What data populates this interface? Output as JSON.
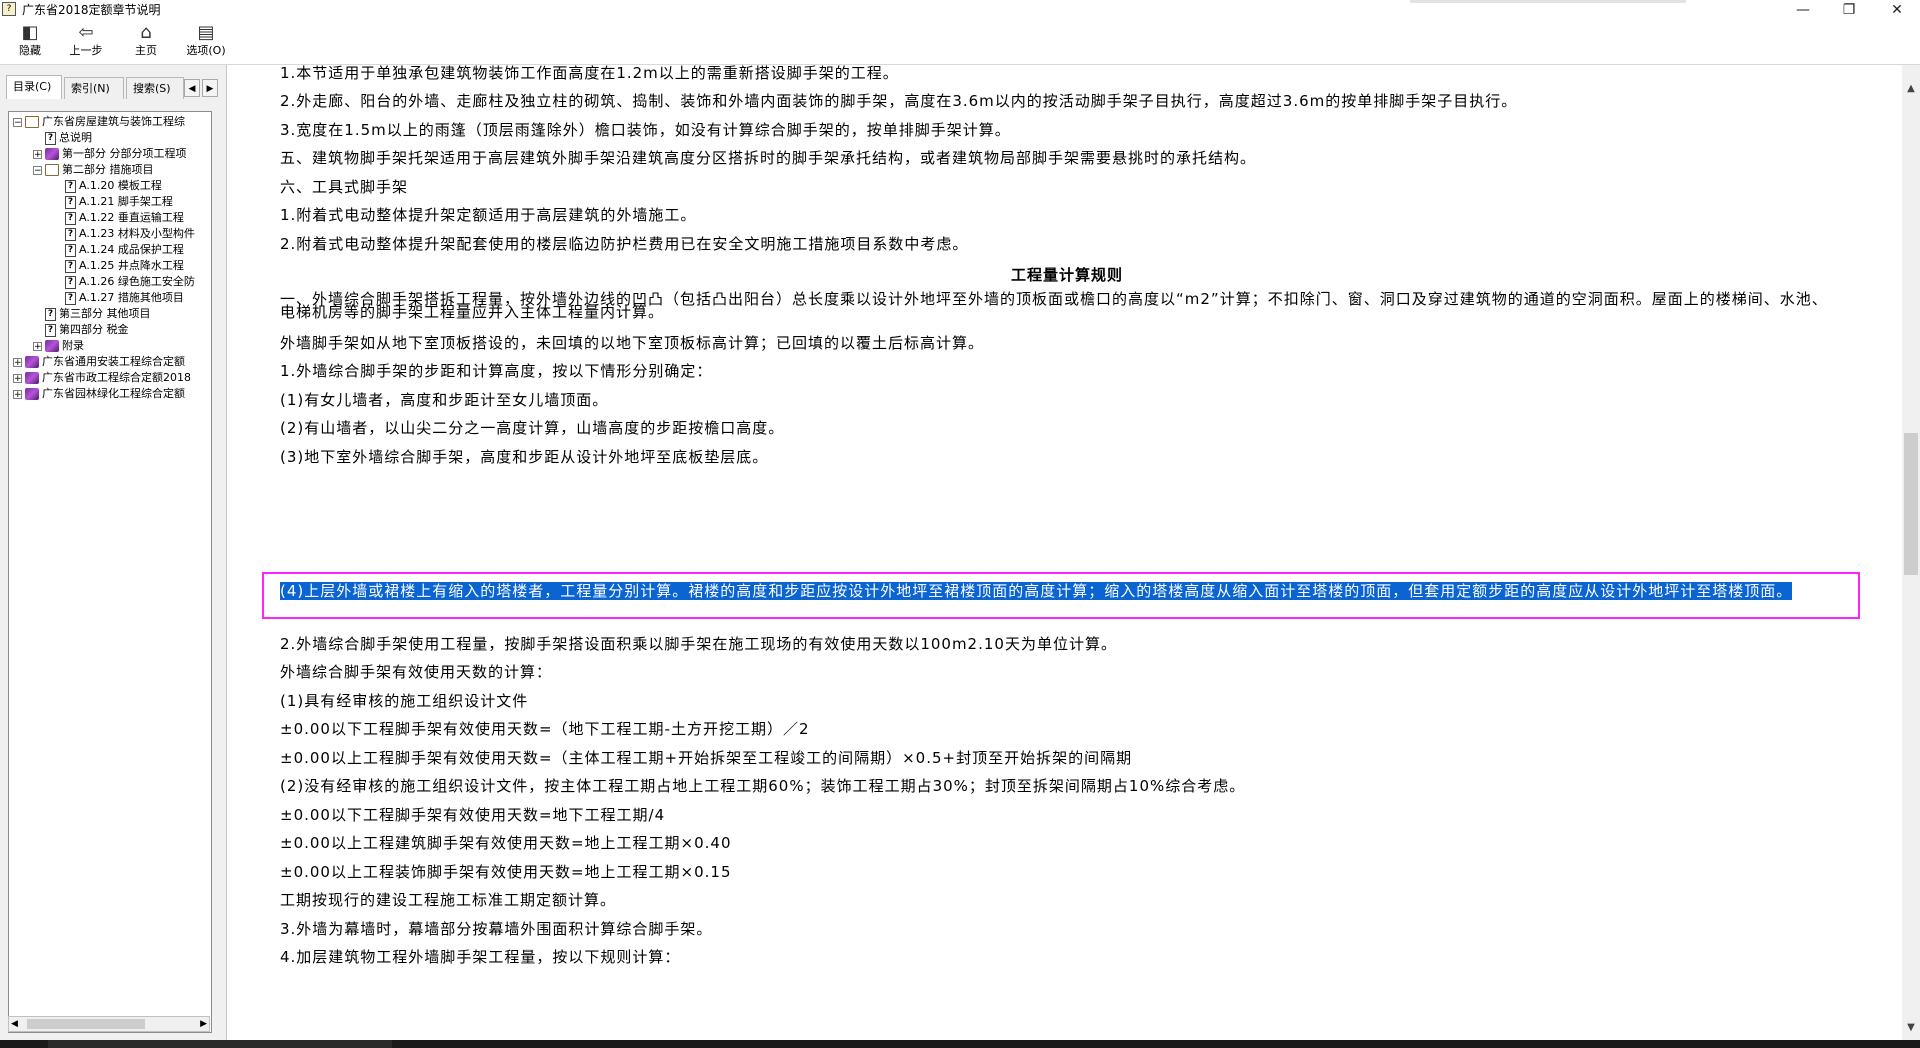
{
  "window": {
    "title": "广东省2018定额章节说明",
    "minimize": "—",
    "maximize": "❐",
    "close": "✕"
  },
  "toolbar": {
    "hide_label": "隐藏",
    "back_label": "上一步",
    "home_label": "主页",
    "options_label": "选项(O)"
  },
  "tabs": {
    "contents": "目录(C)",
    "index": "索引(N)",
    "search": "搜索(S)"
  },
  "tree": [
    {
      "label": "广东省房屋建筑与装饰工程综",
      "icon": "book-open",
      "expander": "⊟",
      "level": 0
    },
    {
      "label": "总说明",
      "icon": "help-page",
      "level": 1
    },
    {
      "label": "第一部分 分部分项工程项",
      "icon": "book",
      "expander": "⊞",
      "level": 1
    },
    {
      "label": "第二部分 措施项目",
      "icon": "book-open",
      "expander": "⊟",
      "level": 1
    },
    {
      "label": "A.1.20 模板工程",
      "icon": "help-page",
      "level": 2
    },
    {
      "label": "A.1.21 脚手架工程",
      "icon": "help-page",
      "level": 2
    },
    {
      "label": "A.1.22 垂直运输工程",
      "icon": "help-page",
      "level": 2
    },
    {
      "label": "A.1.23 材料及小型构件",
      "icon": "help-page",
      "level": 2
    },
    {
      "label": "A.1.24 成品保护工程",
      "icon": "help-page",
      "level": 2
    },
    {
      "label": "A.1.25 井点降水工程",
      "icon": "help-page",
      "level": 2
    },
    {
      "label": "A.1.26 绿色施工安全防",
      "icon": "help-page",
      "level": 2
    },
    {
      "label": "A.1.27 措施其他项目",
      "icon": "help-page",
      "level": 2
    },
    {
      "label": "第三部分 其他项目",
      "icon": "help-page",
      "level": 1
    },
    {
      "label": "第四部分 税金",
      "icon": "help-page",
      "level": 1
    },
    {
      "label": "附录",
      "icon": "book",
      "expander": "⊞",
      "level": 1
    },
    {
      "label": "广东省通用安装工程综合定额",
      "icon": "book",
      "expander": "⊞",
      "level": 0
    },
    {
      "label": "广东省市政工程综合定额2018",
      "icon": "book",
      "expander": "⊞",
      "level": 0
    },
    {
      "label": "广东省园林绿化工程综合定额",
      "icon": "book",
      "expander": "⊞",
      "level": 0
    }
  ],
  "content": {
    "p1": "1.本节适用于单独承包建筑物装饰工作面高度在1.2m以上的需重新搭设脚手架的工程。",
    "p2": "2.外走廊、阳台的外墙、走廊柱及独立柱的砌筑、捣制、装饰和外墙内面装饰的脚手架，高度在3.6m以内的按活动脚手架子目执行，高度超过3.6m的按单排脚手架子目执行。",
    "p3": "3.宽度在1.5m以上的雨篷（顶层雨篷除外）檐口装饰，如没有计算综合脚手架的，按单排脚手架计算。",
    "p4": "五、建筑物脚手架托架适用于高层建筑外脚手架沿建筑高度分区搭拆时的脚手架承托结构，或者建筑物局部脚手架需要悬挑时的承托结构。",
    "p5": "六、工具式脚手架",
    "p6": "1.附着式电动整体提升架定额适用于高层建筑的外墙施工。",
    "p7": "2.附着式电动整体提升架配套使用的楼层临边防护栏费用已在安全文明施工措施项目系数中考虑。",
    "heading": "工程量计算规则",
    "p8": "一、外墙综合脚手架搭拆工程量，按外墙外边线的凹凸（包括凸出阳台）总长度乘以设计外地坪至外墙的顶板面或檐口的高度以“m2”计算；不扣除门、窗、洞口及穿过建筑物的通道的空洞面积。屋面上的楼梯间、水池、电梯机房等的脚手架工程量应并入主体工程量内计算。",
    "p9": "外墙脚手架如从地下室顶板搭设的，未回填的以地下室顶板标高计算；已回填的以覆土后标高计算。",
    "p10": "1.外墙综合脚手架的步距和计算高度，按以下情形分别确定：",
    "p11": "(1)有女儿墙者，高度和步距计至女儿墙顶面。",
    "p12": "(2)有山墙者，以山尖二分之一高度计算，山墙高度的步距按檐口高度。",
    "p13": "(3)地下室外墙综合脚手架，高度和步距从设计外地坪至底板垫层底。",
    "p14": "(4)上层外墙或裙楼上有缩入的塔楼者，工程量分别计算。裙楼的高度和步距应按设计外地坪至裙楼顶面的高度计算；缩入的塔楼高度从缩入面计至塔楼的顶面，但套用定额步距的高度应从设计外地坪计至塔楼顶面。",
    "p15": "2.外墙综合脚手架使用工程量，按脚手架搭设面积乘以脚手架在施工现场的有效使用天数以100m2.10天为单位计算。",
    "p16": "外墙综合脚手架有效使用天数的计算：",
    "p17": "(1)具有经审核的施工组织设计文件",
    "p18": "±0.00以下工程脚手架有效使用天数=（地下工程工期-土方开挖工期）／2",
    "p19": "±0.00以上工程脚手架有效使用天数=（主体工程工期+开始拆架至工程竣工的间隔期）×0.5+封顶至开始拆架的间隔期",
    "p20": "(2)没有经审核的施工组织设计文件，按主体工程工期占地上工程工期60%；装饰工程工期占30%；封顶至拆架间隔期占10%综合考虑。",
    "p21": "±0.00以下工程脚手架有效使用天数=地下工程工期/4",
    "p22": "±0.00以上工程建筑脚手架有效使用天数=地上工程工期×0.40",
    "p23": "±0.00以上工程装饰脚手架有效使用天数=地上工程工期×0.15",
    "p24": "工期按现行的建设工程施工标准工期定额计算。",
    "p25": "3.外墙为幕墙时，幕墙部分按幕墙外围面积计算综合脚手架。",
    "p26": "4.加层建筑物工程外墙脚手架工程量，按以下规则计算："
  },
  "colors": {
    "selection": "#0a64d2",
    "highlight_border": "#ff24ff"
  }
}
